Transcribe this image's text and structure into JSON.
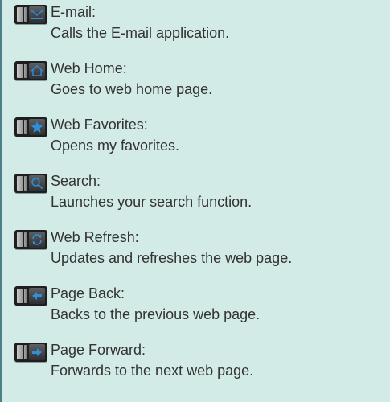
{
  "accent_color": "#2f8fd8",
  "entries": [
    {
      "icon": "envelope-icon",
      "title": "E-mail:",
      "description": "Calls the E-mail application."
    },
    {
      "icon": "home-icon",
      "title": "Web Home:",
      "description": "Goes to web home page."
    },
    {
      "icon": "star-icon",
      "title": "Web Favorites:",
      "description": "Opens my favorites."
    },
    {
      "icon": "search-icon",
      "title": "Search:",
      "description": "Launches your search function."
    },
    {
      "icon": "refresh-icon",
      "title": "Web Refresh:",
      "description": "Updates and refreshes the web page."
    },
    {
      "icon": "arrow-left-icon",
      "title": "Page Back:",
      "description": "Backs to the previous web page."
    },
    {
      "icon": "arrow-right-icon",
      "title": "Page Forward:",
      "description": "Forwards to the next web page."
    }
  ]
}
